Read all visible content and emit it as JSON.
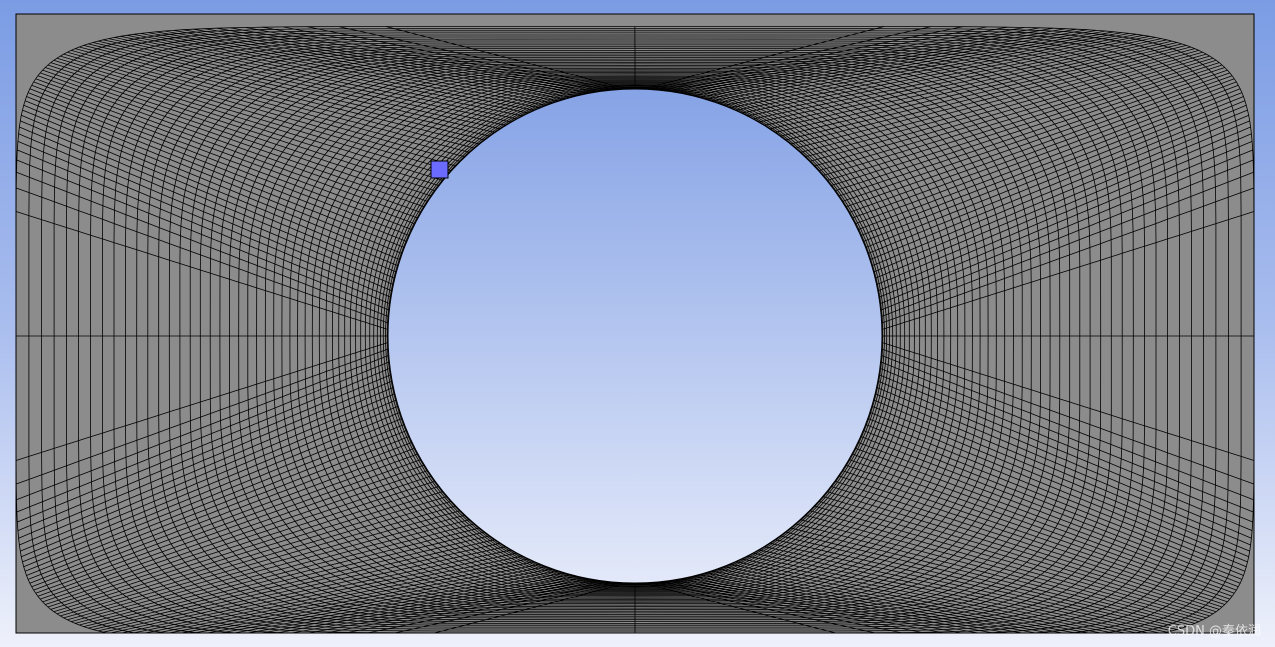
{
  "viewport": {
    "background_top": "#7b9ce4",
    "background_bottom": "#eef1fb"
  },
  "mesh": {
    "face_color": "#8c8c8c",
    "edge_color": "#000000",
    "hole_shape": "circle",
    "element_type": "quadrilateral"
  },
  "selection": {
    "marker_color": "#6b6bff",
    "marker_icon": "selected-node-marker"
  },
  "watermark": {
    "text": "CSDN @秦依润"
  }
}
